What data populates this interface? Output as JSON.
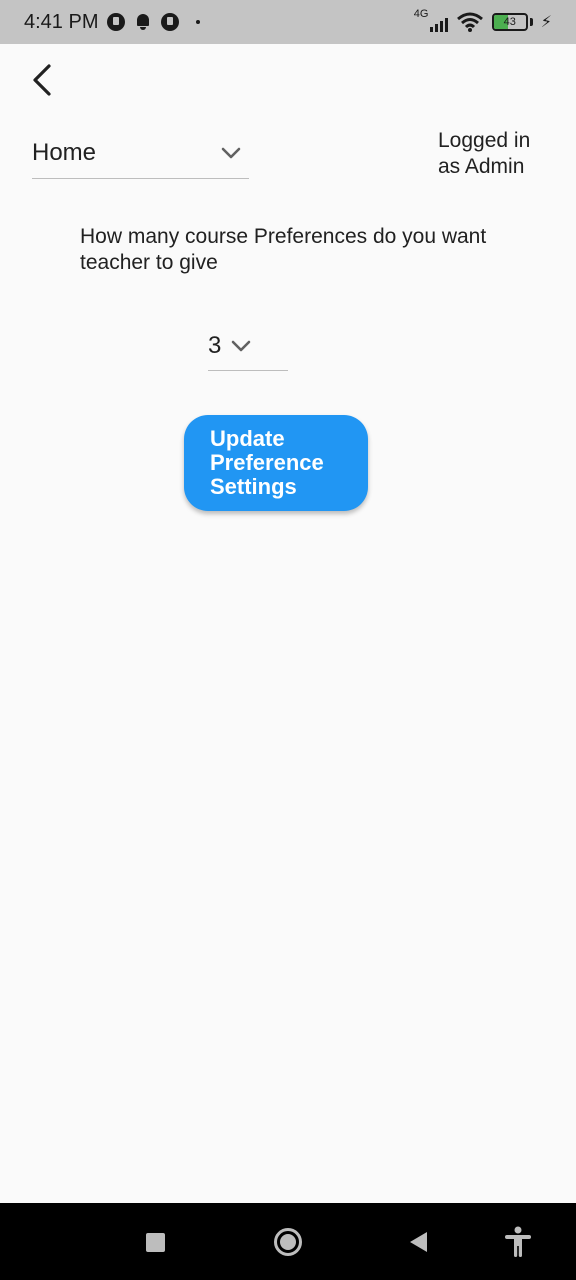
{
  "status_bar": {
    "time": "4:41 PM",
    "network": "4G",
    "battery": "43",
    "battery_level": 0.43,
    "icons": [
      "app-icon",
      "bell-icon",
      "app-icon",
      "dot-icon",
      "signal-icon",
      "wifi-icon",
      "battery-icon",
      "charging-icon"
    ]
  },
  "header": {
    "back_icon": "back-arrow-icon",
    "nav_dropdown": {
      "value": "Home",
      "icon": "chevron-down-icon"
    },
    "login_status": "Logged in as Admin"
  },
  "main": {
    "question": "How many course Preferences do you want teacher to give",
    "preference_count": {
      "value": "3",
      "icon": "chevron-down-icon"
    },
    "update_button": "Update Preference Settings",
    "accent_color": "#2196f3"
  },
  "nav_bar": {
    "icons": [
      "recents-icon",
      "home-icon",
      "back-icon",
      "accessibility-icon"
    ]
  }
}
